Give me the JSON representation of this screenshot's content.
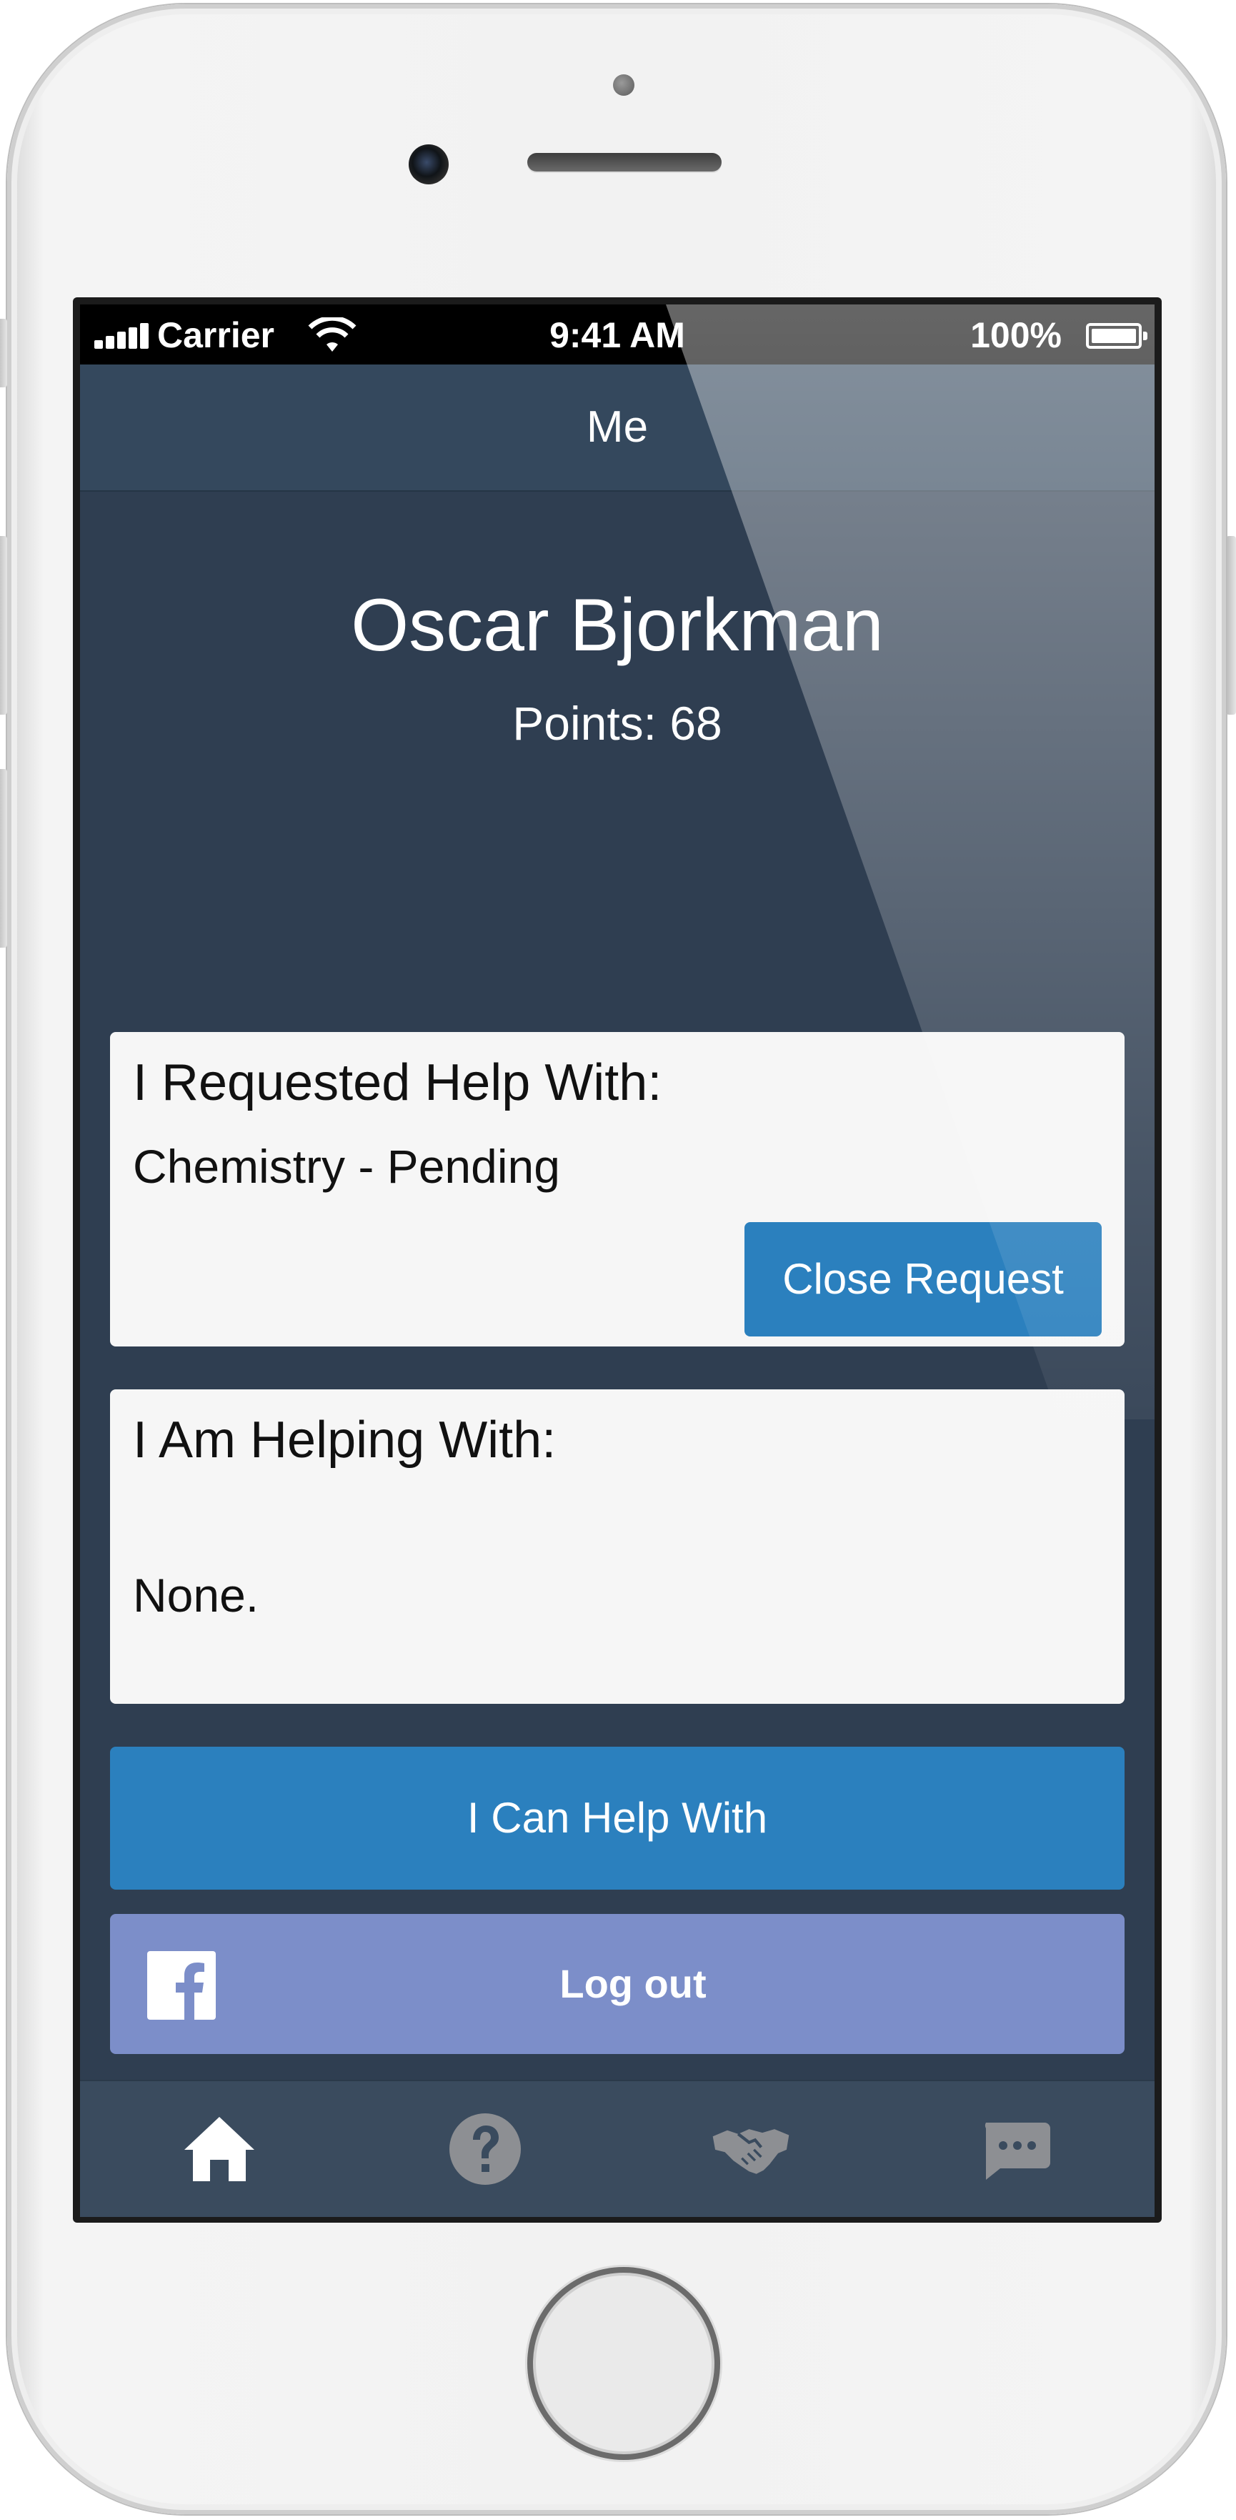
{
  "status_bar": {
    "carrier": "Carrier",
    "time": "9:41 AM",
    "battery": "100%"
  },
  "nav": {
    "title": "Me"
  },
  "profile": {
    "name": "Oscar Bjorkman",
    "points": "Points: 68"
  },
  "requested_card": {
    "title": "I Requested Help With:",
    "item": "Chemistry - Pending",
    "close_button": "Close Request"
  },
  "helping_card": {
    "title": "I Am Helping With:",
    "item": "None."
  },
  "help_button": "I Can Help With",
  "logout_button": "Log out",
  "tabs": [
    {
      "icon": "home-icon",
      "active": true
    },
    {
      "icon": "question-icon",
      "active": false
    },
    {
      "icon": "handshake-icon",
      "active": false
    },
    {
      "icon": "chat-icon",
      "active": false
    }
  ],
  "colors": {
    "background": "#2f3e51",
    "navbar": "#34485d",
    "primary_button": "#2b80be",
    "facebook_button": "#7c8ec9",
    "card": "#f6f6f6"
  }
}
